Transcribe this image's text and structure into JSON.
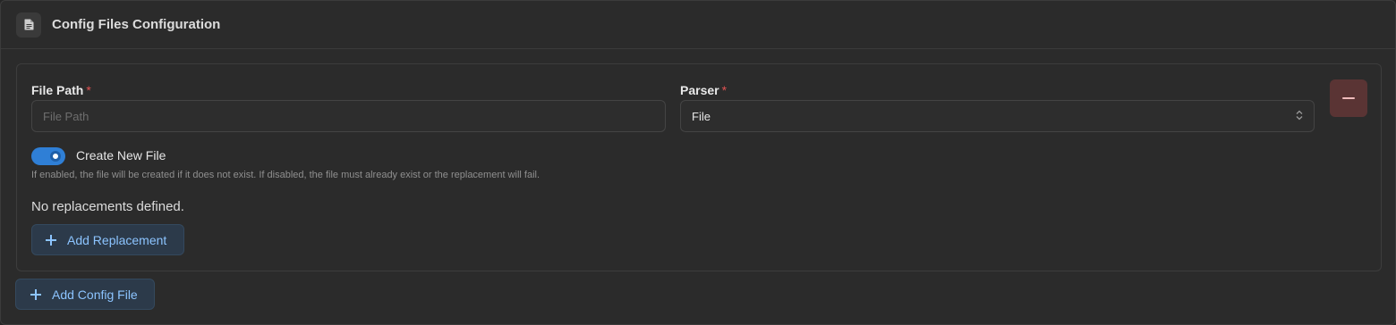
{
  "header": {
    "title": "Config Files Configuration",
    "icon": "document-icon"
  },
  "config_file": {
    "file_path": {
      "label": "File Path",
      "required_marker": "*",
      "placeholder": "File Path",
      "value": ""
    },
    "parser": {
      "label": "Parser",
      "required_marker": "*",
      "value": "File"
    },
    "create_new_file": {
      "label": "Create New File",
      "enabled": true,
      "help": "If enabled, the file will be created if it does not exist. If disabled, the file must already exist or the replacement will fail."
    },
    "replacements_empty": "No replacements defined.",
    "add_replacement_label": "Add Replacement"
  },
  "add_config_file_label": "Add Config File",
  "colors": {
    "accent": "#2f7fd6",
    "danger_bg": "#5a3434",
    "link": "#8cc4ff",
    "required": "#e05252"
  }
}
